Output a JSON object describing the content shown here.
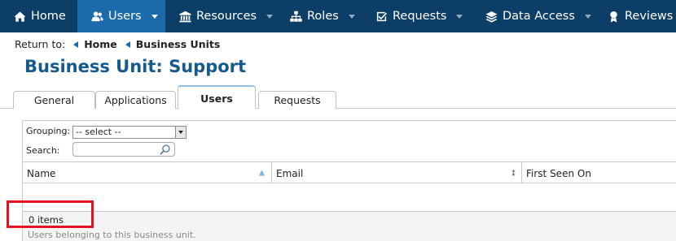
{
  "nav": {
    "items": [
      {
        "label": "Home",
        "icon": "home-icon"
      },
      {
        "label": "Users",
        "icon": "users-icon",
        "active": true
      },
      {
        "label": "Resources",
        "icon": "bank-icon"
      },
      {
        "label": "Roles",
        "icon": "sitemap-icon"
      },
      {
        "label": "Requests",
        "icon": "check-square-icon"
      },
      {
        "label": "Data Access",
        "icon": "layers-icon"
      },
      {
        "label": "Reviews",
        "icon": "award-icon"
      }
    ]
  },
  "breadcrumb": {
    "prefix": "Return to:",
    "items": [
      "Home",
      "Business Units"
    ]
  },
  "page": {
    "title": "Business Unit: Support"
  },
  "tabs": [
    {
      "label": "General"
    },
    {
      "label": "Applications"
    },
    {
      "label": "Users",
      "active": true
    },
    {
      "label": "Requests"
    }
  ],
  "grid": {
    "grouping_label": "Grouping:",
    "grouping_value": "-- select --",
    "search_label": "Search:",
    "search_value": "",
    "columns": [
      "Name",
      "Email",
      "First Seen On"
    ],
    "rows": [],
    "items_count": "0 items",
    "description": "Users belonging to this business unit."
  },
  "colors": {
    "nav_bg": "#0d3e67",
    "nav_active": "#1c6aa9",
    "title": "#155a8f",
    "highlight": "#e0141e"
  }
}
